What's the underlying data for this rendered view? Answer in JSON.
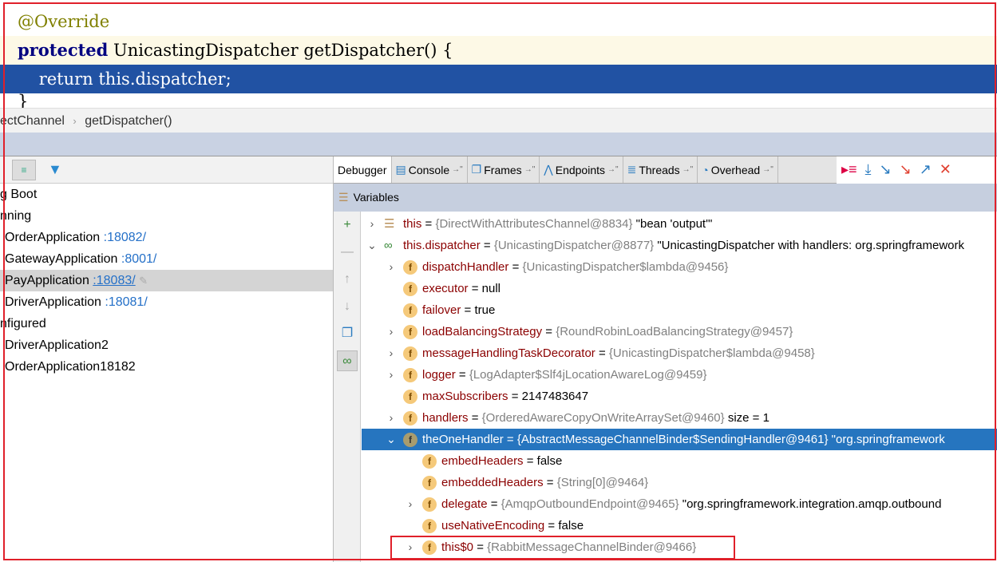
{
  "code": {
    "lines": [
      "@Override",
      "protected",
      " UnicastingDispatcher getDispatcher() {",
      "    return this.dispatcher;",
      "}"
    ]
  },
  "breadcrumb": {
    "items": [
      "ectChannel",
      "getDispatcher()"
    ],
    "separator": "›"
  },
  "services": {
    "rows": [
      {
        "label": "g Boot",
        "port": "",
        "indent": 0
      },
      {
        "label": "nning",
        "port": "",
        "indent": 0
      },
      {
        "label": "OrderApplication",
        "port": ":18082/",
        "indent": 1
      },
      {
        "label": "GatewayApplication",
        "port": ":8001/",
        "indent": 1
      },
      {
        "label": "PayApplication",
        "port": ":18083/",
        "indent": 1,
        "selected": true
      },
      {
        "label": "DriverApplication",
        "port": ":18081/",
        "indent": 1
      },
      {
        "label": "nfigured",
        "port": "",
        "indent": 0
      },
      {
        "label": "DriverApplication2",
        "port": "",
        "indent": 1
      },
      {
        "label": "OrderApplication18182",
        "port": "",
        "indent": 1
      }
    ]
  },
  "debugger": {
    "tabs": [
      {
        "label": "Debugger",
        "icon": "",
        "active": true
      },
      {
        "label": "Console",
        "icon": "console-icon"
      },
      {
        "label": "Frames",
        "icon": "frames-icon"
      },
      {
        "label": "Endpoints",
        "icon": "endpoints-icon"
      },
      {
        "label": "Threads",
        "icon": "threads-icon"
      },
      {
        "label": "Overhead",
        "icon": "overhead-icon"
      }
    ],
    "variables_title": "Variables",
    "variables": [
      {
        "level": 0,
        "arrow": "right",
        "icon": "object",
        "name": "this",
        "value": "{DirectWithAttributesChannel@8834}",
        "extra": " \"bean 'output'\""
      },
      {
        "level": 0,
        "arrow": "down",
        "icon": "watch",
        "name": "this.dispatcher",
        "value": "{UnicastingDispatcher@8877}",
        "extra": " \"UnicastingDispatcher with handlers: org.springframework"
      },
      {
        "level": 1,
        "arrow": "right",
        "icon": "field",
        "name": "dispatchHandler",
        "value": "{UnicastingDispatcher$lambda@9456}",
        "extra": ""
      },
      {
        "level": 1,
        "arrow": "",
        "icon": "field",
        "name": "executor",
        "value": "",
        "extra": "null"
      },
      {
        "level": 1,
        "arrow": "",
        "icon": "field",
        "name": "failover",
        "value": "",
        "extra": "true"
      },
      {
        "level": 1,
        "arrow": "right",
        "icon": "field",
        "name": "loadBalancingStrategy",
        "value": "{RoundRobinLoadBalancingStrategy@9457}",
        "extra": ""
      },
      {
        "level": 1,
        "arrow": "right",
        "icon": "field",
        "name": "messageHandlingTaskDecorator",
        "value": "{UnicastingDispatcher$lambda@9458}",
        "extra": ""
      },
      {
        "level": 1,
        "arrow": "right",
        "icon": "field",
        "name": "logger",
        "value": "{LogAdapter$Slf4jLocationAwareLog@9459}",
        "extra": ""
      },
      {
        "level": 1,
        "arrow": "",
        "icon": "field",
        "name": "maxSubscribers",
        "value": "",
        "extra": "2147483647"
      },
      {
        "level": 1,
        "arrow": "right",
        "icon": "field",
        "name": "handlers",
        "value": "{OrderedAwareCopyOnWriteArraySet@9460}",
        "extra": "  size = 1"
      },
      {
        "level": 1,
        "arrow": "down",
        "icon": "field",
        "name": "theOneHandler",
        "value": "{AbstractMessageChannelBinder$SendingHandler@9461}",
        "extra": " \"org.springframework",
        "selected": true
      },
      {
        "level": 2,
        "arrow": "",
        "icon": "field",
        "name": "embedHeaders",
        "value": "",
        "extra": "false"
      },
      {
        "level": 2,
        "arrow": "",
        "icon": "field",
        "name": "embeddedHeaders",
        "value": "{String[0]@9464}",
        "extra": ""
      },
      {
        "level": 2,
        "arrow": "right",
        "icon": "field",
        "name": "delegate",
        "value": "{AmqpOutboundEndpoint@9465}",
        "extra": " \"org.springframework.integration.amqp.outbound"
      },
      {
        "level": 2,
        "arrow": "",
        "icon": "field",
        "name": "useNativeEncoding",
        "value": "",
        "extra": "false"
      },
      {
        "level": 2,
        "arrow": "right",
        "icon": "field",
        "name": "this$0",
        "value": "{RabbitMessageChannelBinder@9466}",
        "extra": "",
        "highlighted": true
      }
    ]
  },
  "colors": {
    "selection": "#2675bf",
    "current_line": "#2152a3",
    "annotation": "#808000",
    "keyword": "#000080",
    "highlight_box": "#e0202a"
  }
}
